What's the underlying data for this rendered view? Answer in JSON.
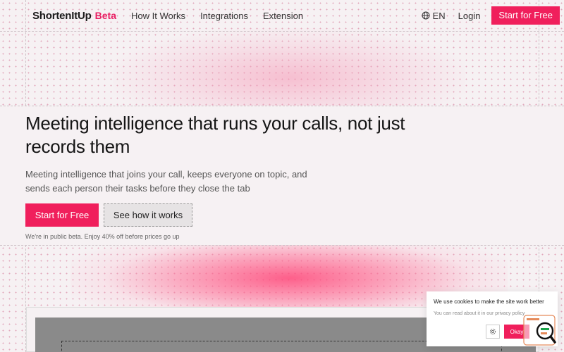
{
  "nav": {
    "brand": "ShortenItUp",
    "beta": "Beta",
    "links": [
      "How It Works",
      "Integrations",
      "Extension"
    ],
    "language": "EN",
    "login": "Login",
    "cta": "Start for Free"
  },
  "hero": {
    "headline": "Meeting intelligence that runs your calls, not just records them",
    "subline": "Meeting intelligence that joins your call, keeps everyone on topic, and sends each person their tasks before they close the tab",
    "primary_button": "Start for Free",
    "secondary_button": "See how it works",
    "note": "We're in public beta. Enjoy 40% off before prices go up"
  },
  "cookie": {
    "title": "We use cookies to make the site work better",
    "text": "You can read about it in our privacy policy",
    "ok": "Okay"
  },
  "colors": {
    "accent": "#f01f5c",
    "background": "#f6f1f3"
  },
  "icons": [
    "globe-icon",
    "gear-icon",
    "search-icon"
  ]
}
